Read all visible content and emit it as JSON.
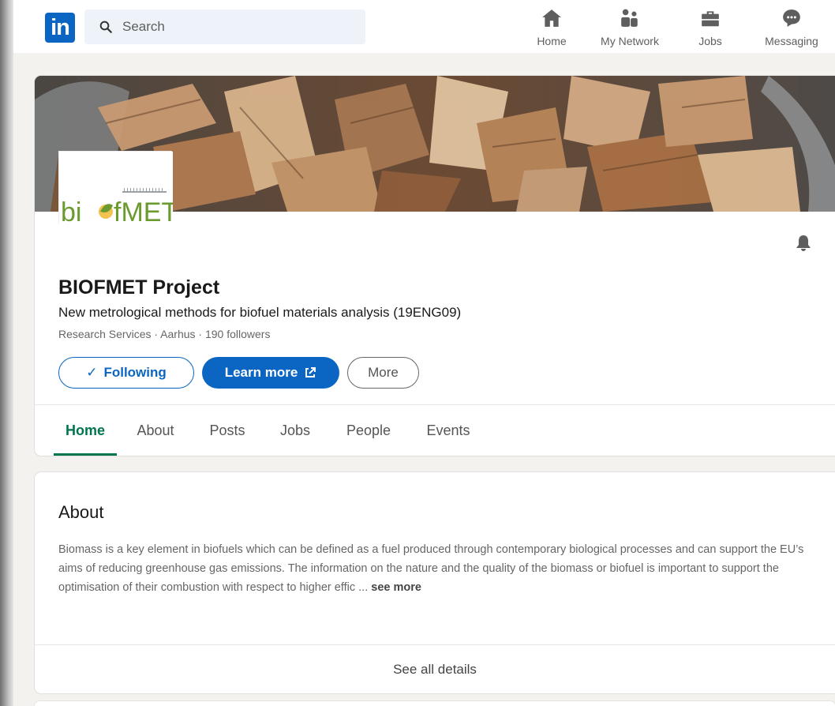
{
  "nav": {
    "logo_text": "in",
    "search_placeholder": "Search",
    "items": [
      {
        "label": "Home",
        "icon": "home-icon"
      },
      {
        "label": "My Network",
        "icon": "people-icon"
      },
      {
        "label": "Jobs",
        "icon": "briefcase-icon"
      },
      {
        "label": "Messaging",
        "icon": "chat-icon"
      }
    ]
  },
  "org": {
    "logo_text_part1": "bi",
    "logo_text_part2": "fMET",
    "name": "BIOFMET Project",
    "tagline": "New metrological methods for biofuel materials analysis (19ENG09)",
    "meta": "Research Services · Aarhus · 190 followers",
    "following_label": "Following",
    "learn_more_label": "Learn more",
    "more_label": "More"
  },
  "tabs": [
    "Home",
    "About",
    "Posts",
    "Jobs",
    "People",
    "Events"
  ],
  "active_tab": "Home",
  "about": {
    "title": "About",
    "text": "Biomass is a key element in biofuels which can be defined as a fuel produced through contemporary biological processes and can support the EU’s aims of reducing greenhouse gas emissions. The information on the nature and the quality of the biomass or biofuel is important to support the optimisation of their combustion with respect to higher effic ... ",
    "see_more": "see more",
    "see_all": "See all details"
  },
  "colors": {
    "brand_blue": "#0a66c2",
    "active_tab_green": "#01754f",
    "page_bg": "#f4f2ee"
  }
}
